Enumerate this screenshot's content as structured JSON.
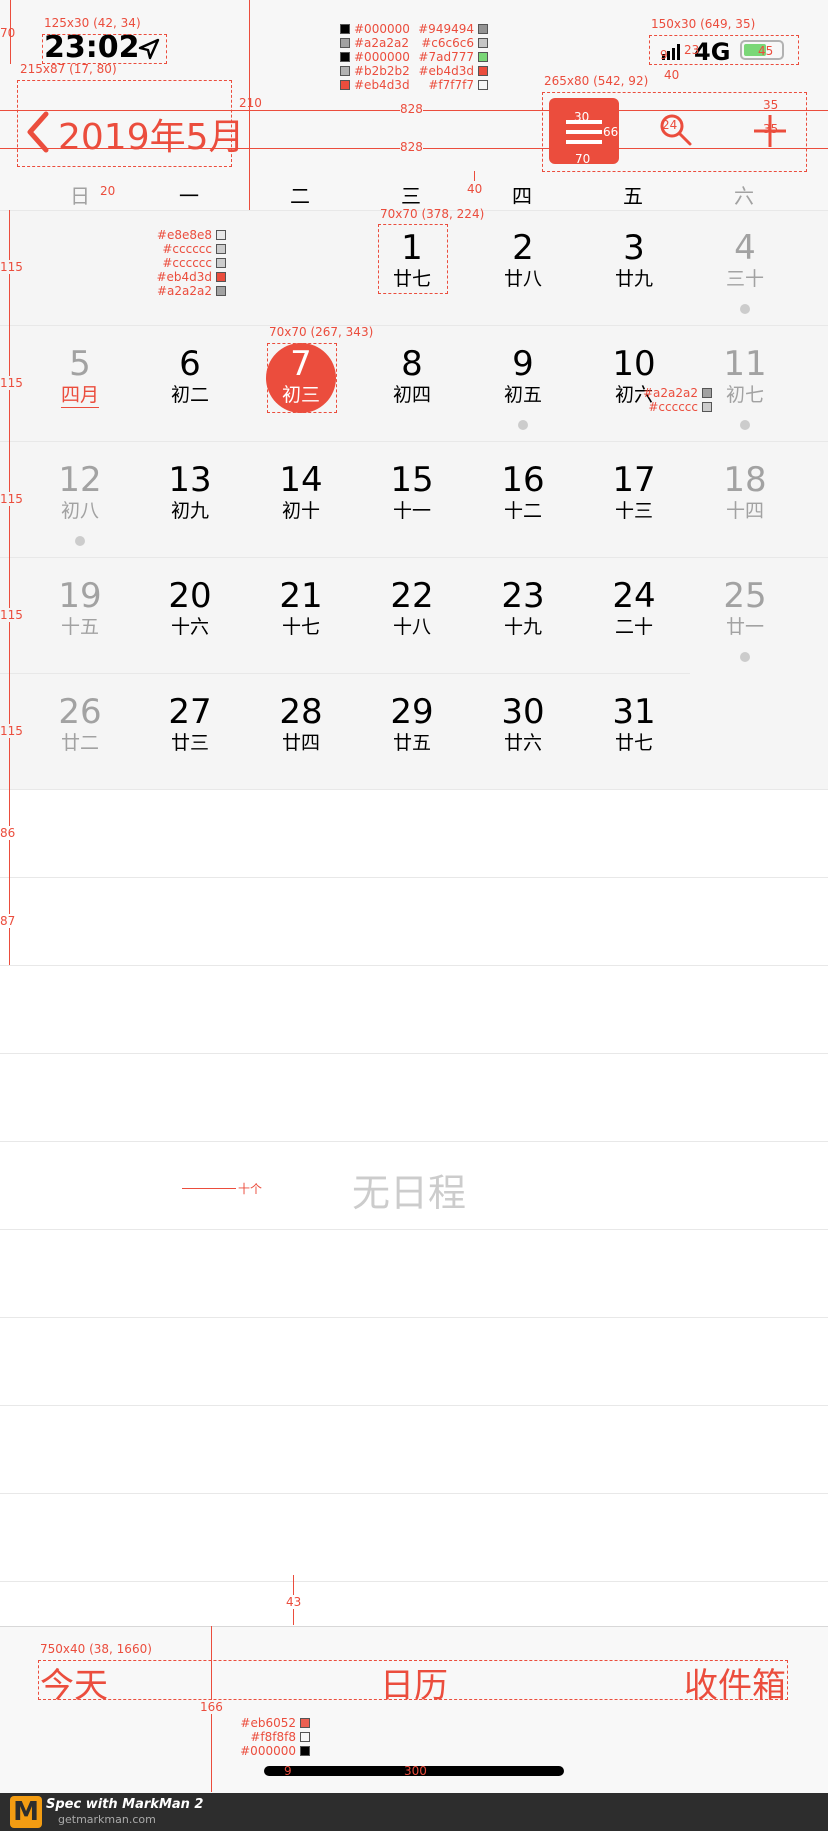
{
  "status_bar": {
    "time": "23:02",
    "network": "4G"
  },
  "nav": {
    "title": "2019年5月"
  },
  "weekdays": [
    "日",
    "一",
    "二",
    "三",
    "四",
    "五",
    "六"
  ],
  "calendar": {
    "rows": [
      [
        null,
        null,
        null,
        {
          "day": "1",
          "lunar": "廿七"
        },
        {
          "day": "2",
          "lunar": "廿八"
        },
        {
          "day": "3",
          "lunar": "廿九"
        },
        {
          "day": "4",
          "lunar": "三十"
        }
      ],
      [
        {
          "day": "5",
          "lunar": "四月"
        },
        {
          "day": "6",
          "lunar": "初二"
        },
        {
          "day": "7",
          "lunar": "初三"
        },
        {
          "day": "8",
          "lunar": "初四"
        },
        {
          "day": "9",
          "lunar": "初五"
        },
        {
          "day": "10",
          "lunar": "初六"
        },
        {
          "day": "11",
          "lunar": "初七"
        }
      ],
      [
        {
          "day": "12",
          "lunar": "初八"
        },
        {
          "day": "13",
          "lunar": "初九"
        },
        {
          "day": "14",
          "lunar": "初十"
        },
        {
          "day": "15",
          "lunar": "十一"
        },
        {
          "day": "16",
          "lunar": "十二"
        },
        {
          "day": "17",
          "lunar": "十三"
        },
        {
          "day": "18",
          "lunar": "十四"
        }
      ],
      [
        {
          "day": "19",
          "lunar": "十五"
        },
        {
          "day": "20",
          "lunar": "十六"
        },
        {
          "day": "21",
          "lunar": "十七"
        },
        {
          "day": "22",
          "lunar": "十八"
        },
        {
          "day": "23",
          "lunar": "十九"
        },
        {
          "day": "24",
          "lunar": "二十"
        },
        {
          "day": "25",
          "lunar": "廿一"
        }
      ],
      [
        {
          "day": "26",
          "lunar": "廿二"
        },
        {
          "day": "27",
          "lunar": "廿三"
        },
        {
          "day": "28",
          "lunar": "廿四"
        },
        {
          "day": "29",
          "lunar": "廿五"
        },
        {
          "day": "30",
          "lunar": "廿六"
        },
        {
          "day": "31",
          "lunar": "廿七"
        },
        null
      ]
    ]
  },
  "empty_state": "无日程",
  "tabs": {
    "today": "今天",
    "calendar": "日历",
    "inbox": "收件箱"
  },
  "colors": {
    "accent": "#eb4d3d",
    "text": "#000000",
    "muted": "#a2a2a2",
    "dot": "#cccccc",
    "separator": "#e8e8e8",
    "background": "#f7f7f7",
    "tabbar": "#f8f8f8",
    "battery": "#7ad777"
  },
  "annotations": {
    "time_box": "125x30 (42, 34)",
    "title_box": "215x87 (17, 80)",
    "signal_box": "150x30 (649, 35)",
    "toolbar_box": "265x80 (542, 92)",
    "day1_box": "70x70 (378, 224)",
    "today_box": "70x70 (267, 343)",
    "tabbar_box": "750x40 (38, 1660)",
    "width_828": "828",
    "h210": "210",
    "h70": "70",
    "w20": "20",
    "h40": "40",
    "w35": "35",
    "w30": "30",
    "w66": "66",
    "w70": "70",
    "w24": "24",
    "h115": "115",
    "h86": "86",
    "h87": "87",
    "h43": "43",
    "h166": "166",
    "n23": "23",
    "n9": "9",
    "n40": "40",
    "n45": "45",
    "w300": "300",
    "w10": "10",
    "ten_items": "十个",
    "status_colors": [
      "#000000",
      "#a2a2a2",
      "#000000",
      "#b2b2b2",
      "#eb4d3d"
    ],
    "status_colors2": [
      "#949494",
      "#c6c6c6",
      "#7ad777",
      "#eb4d3d",
      "#f7f7f7"
    ],
    "day_colors": [
      "#e8e8e8",
      "#cccccc",
      "#cccccc",
      "#eb4d3d",
      "#a2a2a2"
    ],
    "weekend_colors": [
      "#a2a2a2",
      "#cccccc"
    ],
    "tab_colors": [
      "#eb6052",
      "#f8f8f8",
      "#000000"
    ]
  },
  "footer": {
    "brand": "Spec with MarkMan 2",
    "site": "getmarkman.com"
  }
}
